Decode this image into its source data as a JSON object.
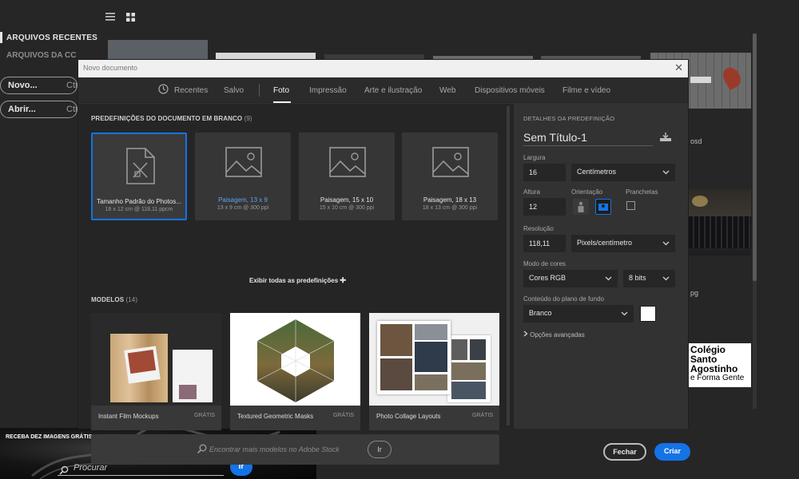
{
  "home": {
    "sidebar": {
      "recent_label": "ARQUIVOS RECENTES",
      "cc_label": "ARQUIVOS DA CC",
      "new_button": "Novo...",
      "new_shortcut": "Ctr",
      "open_button": "Abrir...",
      "open_shortcut": "Ctr"
    },
    "right_texts": {
      "psd": "osd",
      "ext": "pg"
    },
    "colegio": {
      "line1": "Colégio",
      "line2": "Santo",
      "line3": "Agostinho",
      "line4": "e Forma Gente"
    },
    "stock": {
      "title": "RECEBA DEZ IMAGENS GRÁTIS DO ADOBE STOCK",
      "search_placeholder": "Procurar",
      "go_label": "Ir"
    }
  },
  "dialog": {
    "title": "Novo documento",
    "tabs": [
      {
        "label": "Recentes"
      },
      {
        "label": "Salvo"
      },
      {
        "label": "Foto",
        "active": true
      },
      {
        "label": "Impressão"
      },
      {
        "label": "Arte e ilustração"
      },
      {
        "label": "Web"
      },
      {
        "label": "Dispositivos móveis"
      },
      {
        "label": "Filme e vídeo"
      }
    ],
    "blank_presets": {
      "heading": "PREDEFINIÇÕES DO DOCUMENTO EM BRANCO",
      "count": "(9)",
      "items": [
        {
          "name": "Tamanho Padrão do Photos...",
          "dims": "16 x 12 cm @ 118,11 ppcm",
          "selected": true,
          "icon": "document-brush-icon"
        },
        {
          "name": "Paisagem, 13 x 9",
          "dims": "13 x 9 cm @ 300 ppi",
          "highlight": true,
          "icon": "landscape-image-icon"
        },
        {
          "name": "Paisagem, 15 x 10",
          "dims": "15 x 10 cm @ 300 ppi",
          "icon": "landscape-image-icon"
        },
        {
          "name": "Paisagem, 18 x 13",
          "dims": "18 x 13 cm @ 300 ppi",
          "icon": "landscape-image-icon"
        }
      ],
      "show_all": "Exibir todas as predefinições"
    },
    "models": {
      "heading": "MODELOS",
      "count": "(14)",
      "items": [
        {
          "name": "Instant Film Mockups",
          "price": "GRÁTIS"
        },
        {
          "name": "Textured Geometric Masks",
          "price": "GRÁTIS"
        },
        {
          "name": "Photo Collage Layouts",
          "price": "GRÁTIS"
        }
      ]
    },
    "find": {
      "placeholder": "Encontrar mais modelos no Adobe Stock",
      "go_label": "Ir"
    },
    "details": {
      "heading": "DETALHES DA PREDEFINIÇÃO",
      "doc_name": "Sem Título-1",
      "width_label": "Largura",
      "width_value": "16",
      "width_unit": "Centímetros",
      "height_label": "Altura",
      "height_value": "12",
      "orientation_label": "Orientação",
      "artboards_label": "Pranchetas",
      "resolution_label": "Resolução",
      "resolution_value": "118,11",
      "resolution_unit": "Pixels/centímetro",
      "color_mode_label": "Modo de cores",
      "color_mode": "Cores RGB",
      "bit_depth": "8 bits",
      "background_label": "Conteúdo do plano de fundo",
      "background_value": "Branco",
      "advanced_label": "Opções avançadas",
      "close_button": "Fechar",
      "create_button": "Criar"
    }
  },
  "colors": {
    "accent": "#1473e6",
    "dialog_bg": "#323232",
    "pane_bg": "#252525"
  }
}
